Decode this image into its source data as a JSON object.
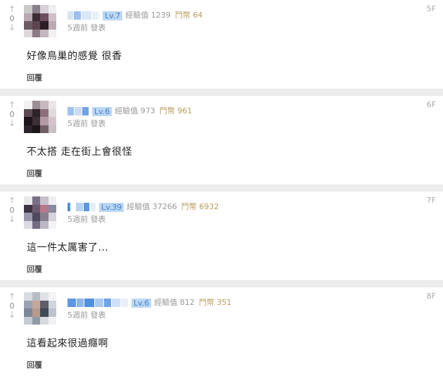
{
  "comments": [
    {
      "floor": "5F",
      "vote_up": "↑",
      "vote_count": "0",
      "vote_down": "↓",
      "level": "Lv.7",
      "exp": "經驗值 1239",
      "coins": "鬥幣 64",
      "date": "5週前 發表",
      "text": "好像鳥巢的感覺 很香",
      "reply": "回覆"
    },
    {
      "floor": "6F",
      "vote_up": "↑",
      "vote_count": "0",
      "vote_down": "↓",
      "level": "Lv.6",
      "exp": "經驗值 973",
      "coins": "鬥幣 961",
      "date": "5週前 發表",
      "text": "不太搭 走在街上會很怪",
      "reply": "回覆"
    },
    {
      "floor": "7F",
      "vote_up": "↑",
      "vote_count": "0",
      "vote_down": "↓",
      "level": "Lv.39",
      "exp": "經驗值 37266",
      "coins": "鬥幣 6932",
      "date": "5週前 發表",
      "text": "這一件太厲害了...",
      "reply": "回覆"
    },
    {
      "floor": "8F",
      "vote_up": "↑",
      "vote_count": "0",
      "vote_down": "↓",
      "level": "Lv.6",
      "exp": "經驗值 812",
      "coins": "鬥幣 351",
      "date": "5週前 發表",
      "text": "這看起來很過癮啊",
      "reply": "回覆"
    }
  ]
}
